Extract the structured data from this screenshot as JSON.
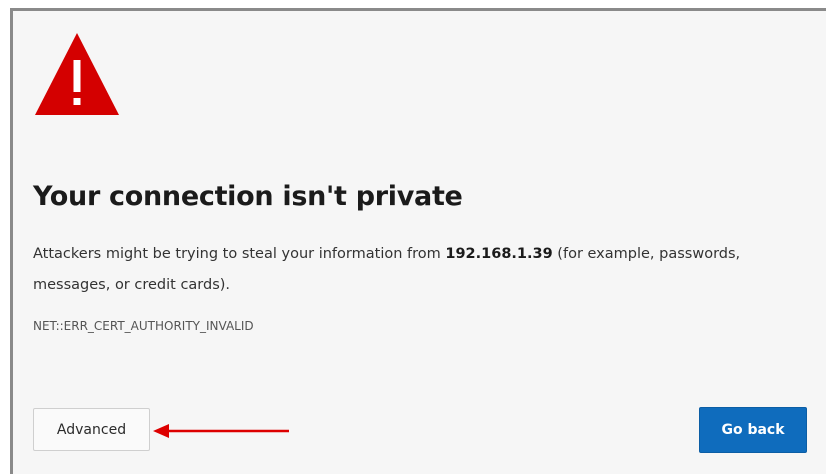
{
  "page": {
    "title": "Your connection isn't private",
    "message_before": "Attackers might be trying to steal your information from ",
    "host": "192.168.1.39",
    "message_after": " (for example, passwords, messages, or credit cards).",
    "error_code": "NET::ERR_CERT_AUTHORITY_INVALID"
  },
  "buttons": {
    "advanced_label": "Advanced",
    "go_back_label": "Go back"
  },
  "icons": {
    "warning": "warning-triangle-icon",
    "annotation": "red-arrow-icon"
  },
  "colors": {
    "warning_red": "#d40000",
    "primary_blue": "#0f6cbd",
    "annotation_red": "#dd0000"
  }
}
